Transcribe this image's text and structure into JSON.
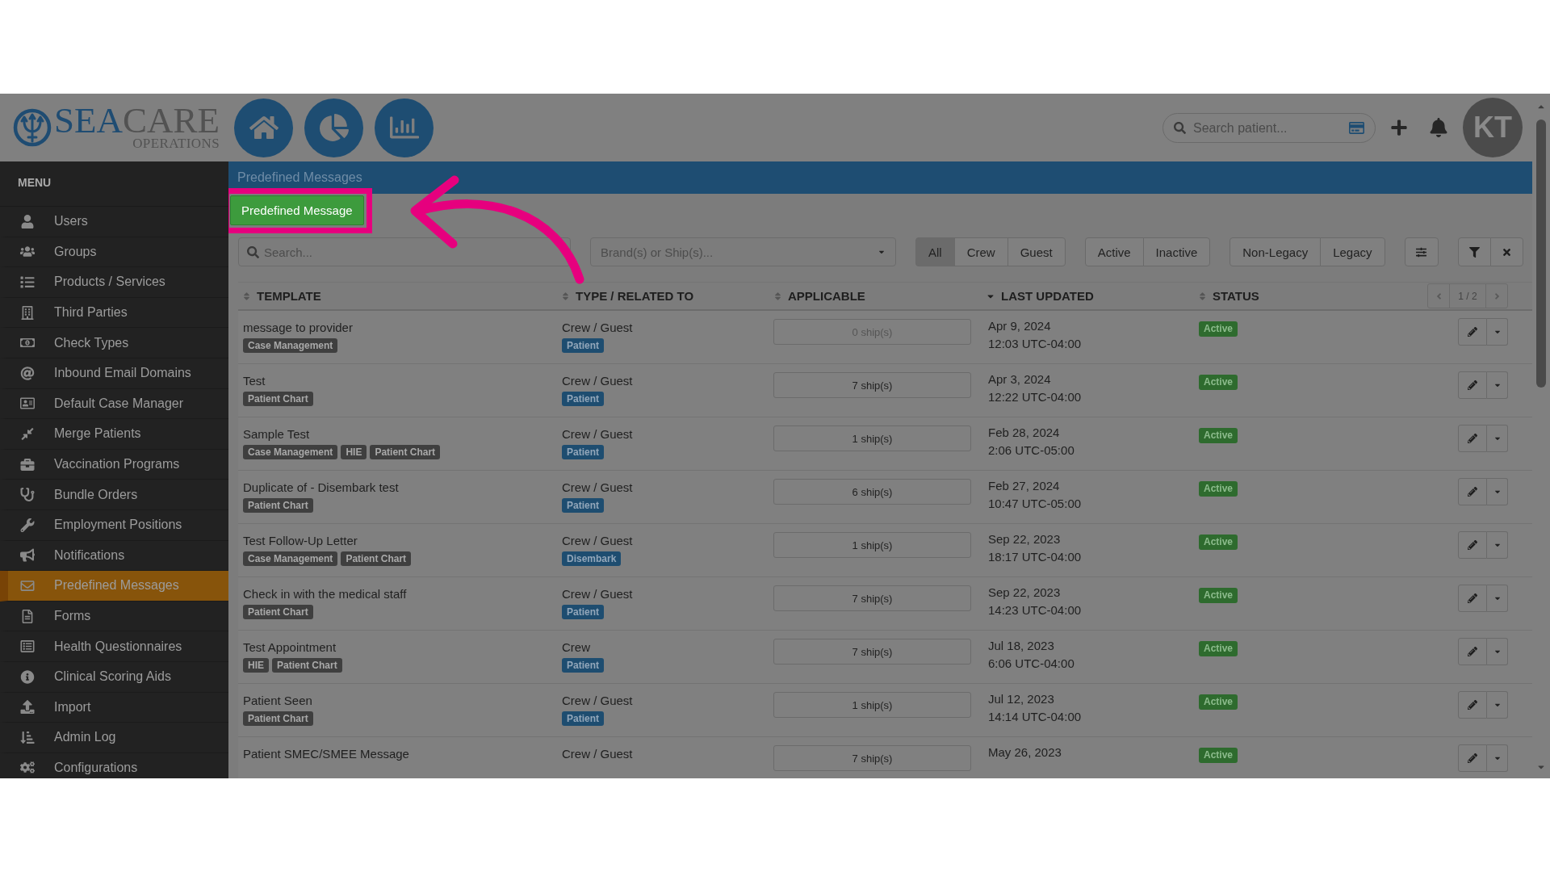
{
  "header": {
    "logo": {
      "wordmark_parts": [
        "SEA",
        "CARE"
      ],
      "tagline": "OPERATIONS"
    },
    "patient_search": {
      "placeholder": "Search patient..."
    },
    "avatar": {
      "initials": "KT"
    }
  },
  "sidebar": {
    "title": "MENU",
    "items": [
      {
        "label": "Users",
        "selected": false
      },
      {
        "label": "Groups",
        "selected": false
      },
      {
        "label": "Products / Services",
        "selected": false
      },
      {
        "label": "Third Parties",
        "selected": false
      },
      {
        "label": "Check Types",
        "selected": false
      },
      {
        "label": "Inbound Email Domains",
        "selected": false
      },
      {
        "label": "Default Case Manager",
        "selected": false
      },
      {
        "label": "Merge Patients",
        "selected": false
      },
      {
        "label": "Vaccination Programs",
        "selected": false
      },
      {
        "label": "Bundle Orders",
        "selected": false
      },
      {
        "label": "Employment Positions",
        "selected": false
      },
      {
        "label": "Notifications",
        "selected": false
      },
      {
        "label": "Predefined Messages",
        "selected": true
      },
      {
        "label": "Forms",
        "selected": false
      },
      {
        "label": "Health Questionnaires",
        "selected": false
      },
      {
        "label": "Clinical Scoring Aids",
        "selected": false
      },
      {
        "label": "Import",
        "selected": false
      },
      {
        "label": "Admin Log",
        "selected": false
      },
      {
        "label": "Configurations",
        "selected": false
      }
    ]
  },
  "page": {
    "title": "Predefined Messages",
    "new_button": {
      "label": "Predefined Message",
      "highlighted": true
    },
    "filters": {
      "search": {
        "placeholder": "Search..."
      },
      "brand_select": {
        "placeholder": "Brand(s) or Ship(s)..."
      },
      "toggle_groups": [
        {
          "options": [
            {
              "label": "All",
              "selected": true
            },
            {
              "label": "Crew",
              "selected": false
            },
            {
              "label": "Guest",
              "selected": false
            }
          ]
        },
        {
          "options": [
            {
              "label": "Active",
              "selected": false
            },
            {
              "label": "Inactive",
              "selected": false
            }
          ]
        },
        {
          "options": [
            {
              "label": "Non-Legacy",
              "selected": false
            },
            {
              "label": "Legacy",
              "selected": false
            }
          ]
        }
      ]
    },
    "table": {
      "columns": [
        {
          "label": "TEMPLATE",
          "sorted": false
        },
        {
          "label": "TYPE / RELATED TO",
          "sorted": false
        },
        {
          "label": "APPLICABLE",
          "sorted": false
        },
        {
          "label": "LAST UPDATED",
          "sorted": true
        },
        {
          "label": "STATUS",
          "sorted": false
        }
      ],
      "page_indicator": "1 / 2",
      "rows": [
        {
          "title": "message to provider",
          "tags": [
            "Case Management"
          ],
          "type": "Crew / Guest",
          "related": [
            "Patient"
          ],
          "applicable": {
            "label": "0 ship(s)",
            "muted": true
          },
          "date": "Apr 9, 2024",
          "time": "12:03 UTC-04:00",
          "status": "Active"
        },
        {
          "title": "Test",
          "tags": [
            "Patient Chart"
          ],
          "type": "Crew / Guest",
          "related": [
            "Patient"
          ],
          "applicable": {
            "label": "7 ship(s)",
            "muted": false
          },
          "date": "Apr 3, 2024",
          "time": "12:22 UTC-04:00",
          "status": "Active"
        },
        {
          "title": "Sample Test",
          "tags": [
            "Case Management",
            "HIE",
            "Patient Chart"
          ],
          "type": "Crew / Guest",
          "related": [
            "Patient"
          ],
          "applicable": {
            "label": "1 ship(s)",
            "muted": false
          },
          "date": "Feb 28, 2024",
          "time": "2:06 UTC-05:00",
          "status": "Active"
        },
        {
          "title": "Duplicate of - Disembark test",
          "tags": [
            "Patient Chart"
          ],
          "type": "Crew / Guest",
          "related": [
            "Patient"
          ],
          "applicable": {
            "label": "6 ship(s)",
            "muted": false
          },
          "date": "Feb 27, 2024",
          "time": "10:47 UTC-05:00",
          "status": "Active"
        },
        {
          "title": "Test Follow-Up Letter",
          "tags": [
            "Case Management",
            "Patient Chart"
          ],
          "type": "Crew / Guest",
          "related": [
            "Disembark"
          ],
          "applicable": {
            "label": "1 ship(s)",
            "muted": false
          },
          "date": "Sep 22, 2023",
          "time": "18:17 UTC-04:00",
          "status": "Active"
        },
        {
          "title": "Check in with the medical staff",
          "tags": [
            "Patient Chart"
          ],
          "type": "Crew / Guest",
          "related": [
            "Patient"
          ],
          "applicable": {
            "label": "7 ship(s)",
            "muted": false
          },
          "date": "Sep 22, 2023",
          "time": "14:23 UTC-04:00",
          "status": "Active"
        },
        {
          "title": "Test Appointment",
          "tags": [
            "HIE",
            "Patient Chart"
          ],
          "type": "Crew",
          "related": [
            "Patient"
          ],
          "applicable": {
            "label": "7 ship(s)",
            "muted": false
          },
          "date": "Jul 18, 2023",
          "time": "6:06 UTC-04:00",
          "status": "Active"
        },
        {
          "title": "Patient Seen",
          "tags": [
            "Patient Chart"
          ],
          "type": "Crew / Guest",
          "related": [
            "Patient"
          ],
          "applicable": {
            "label": "1 ship(s)",
            "muted": false
          },
          "date": "Jul 12, 2023",
          "time": "14:14 UTC-04:00",
          "status": "Active"
        },
        {
          "title": "Patient SMEC/SMEE Message",
          "type": "Crew / Guest",
          "applicable": {
            "label": "7 ship(s)",
            "muted": false
          },
          "date": "May 26, 2023",
          "status": "Active"
        }
      ]
    }
  }
}
